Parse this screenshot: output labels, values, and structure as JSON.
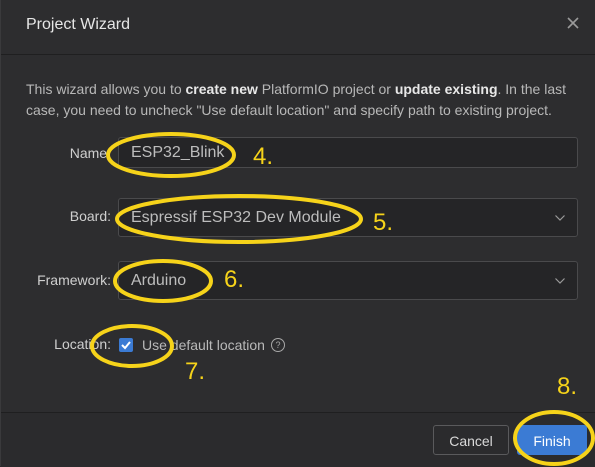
{
  "dialog": {
    "title": "Project Wizard",
    "intro": {
      "p1": "This wizard allows you to ",
      "b1": "create new",
      "p2": " PlatformIO project or ",
      "b2": "update existing",
      "p3": ". In the last case, you need to uncheck \"Use default location\" and specify path to existing project."
    },
    "fields": {
      "name": {
        "label": "Name",
        "value": "ESP32_Blink"
      },
      "board": {
        "label": "Board",
        "value": "Espressif ESP32 Dev Module"
      },
      "framework": {
        "label": "Framework",
        "value": "Arduino"
      },
      "location": {
        "label": "Location",
        "checkbox_label": "Use default location",
        "checked": true
      }
    },
    "buttons": {
      "cancel": "Cancel",
      "finish": "Finish"
    }
  },
  "annotations": {
    "step4": "4.",
    "step5": "5.",
    "step6": "6.",
    "step7": "7.",
    "step8": "8.",
    "color": "#f6d31a"
  },
  "colors": {
    "accent": "#3b7bd4",
    "background": "#2d2d2f"
  }
}
